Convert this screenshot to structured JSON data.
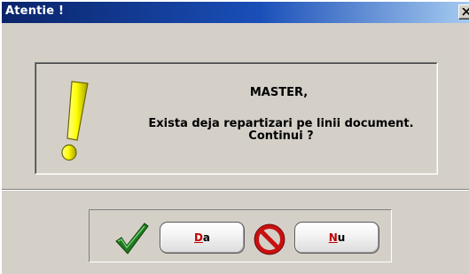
{
  "window": {
    "title": "Atentie !"
  },
  "message": {
    "title": "MASTER,",
    "line1": "Exista deja repartizari pe linii document.",
    "line2": "Continui ?"
  },
  "buttons": {
    "yes": {
      "hotkey": "D",
      "rest": "a"
    },
    "no": {
      "hotkey": "N",
      "rest": "u"
    }
  },
  "icons": {
    "warning": "exclamation-icon",
    "confirm": "checkmark-icon",
    "cancel": "stop-icon",
    "close": "close-icon"
  },
  "colors": {
    "titlebar_start": "#0a246a",
    "titlebar_end": "#a6caf0",
    "dialog_bg": "#d4d0c8",
    "hotkey": "#c00000"
  }
}
